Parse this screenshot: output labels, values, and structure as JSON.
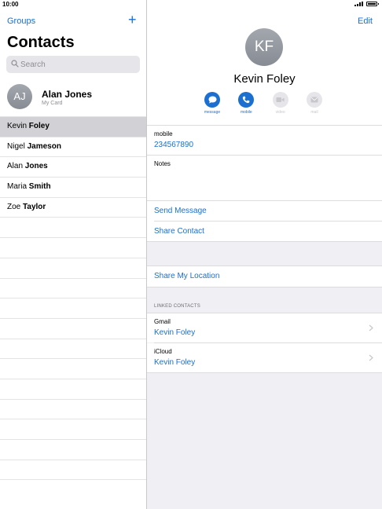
{
  "status_bar": {
    "time": "10:00"
  },
  "left": {
    "groups_label": "Groups",
    "title": "Contacts",
    "search": {
      "placeholder": "Search"
    },
    "my_card": {
      "initials": "AJ",
      "name": "Alan Jones",
      "subtitle": "My Card"
    },
    "contacts": [
      {
        "first": "Kevin ",
        "last": "Foley",
        "selected": true
      },
      {
        "first": "Nigel ",
        "last": "Jameson",
        "selected": false
      },
      {
        "first": "Alan ",
        "last": "Jones",
        "selected": false
      },
      {
        "first": "Maria ",
        "last": "Smith",
        "selected": false
      },
      {
        "first": "Zoe ",
        "last": "Taylor",
        "selected": false
      }
    ]
  },
  "right": {
    "edit_label": "Edit",
    "initials": "KF",
    "name": "Kevin Foley",
    "actions": [
      {
        "label": "message",
        "icon": "message-icon",
        "active": true
      },
      {
        "label": "mobile",
        "icon": "phone-icon",
        "active": true
      },
      {
        "label": "video",
        "icon": "video-icon",
        "active": false
      },
      {
        "label": "mail",
        "icon": "mail-icon",
        "active": false
      }
    ],
    "phone": {
      "label": "mobile",
      "value": "234567890"
    },
    "notes_label": "Notes",
    "send_message": "Send Message",
    "share_contact": "Share Contact",
    "share_location": "Share My Location",
    "linked_header": "LINKED CONTACTS",
    "linked": [
      {
        "source": "Gmail",
        "name": "Kevin Foley"
      },
      {
        "source": "iCloud",
        "name": "Kevin Foley"
      }
    ]
  },
  "colors": {
    "accent": "#1a6fd0",
    "selected_row": "#d1d1d6",
    "group_bg": "#efeff4"
  }
}
